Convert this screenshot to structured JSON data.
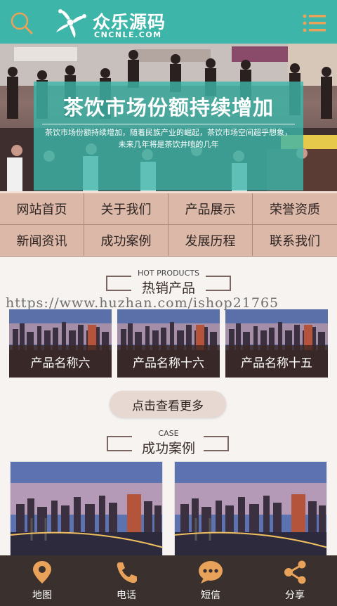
{
  "header": {
    "logo_title": "众乐源码",
    "logo_sub": "CNCNLE.COM",
    "search_icon": "search-icon",
    "menu_icon": "list-menu-icon",
    "accent": "#3db5a8"
  },
  "banner": {
    "title": "茶饮市场份额持续增加",
    "text": "茶饮市场份额持续增加，随着民族产业的崛起，茶饮市场空间超乎想象，未来几年将是茶饮井喷的几年"
  },
  "nav": {
    "items": [
      {
        "label": "网站首页"
      },
      {
        "label": "关于我们"
      },
      {
        "label": "产品展示"
      },
      {
        "label": "荣誉资质"
      },
      {
        "label": "新闻资讯"
      },
      {
        "label": "成功案例"
      },
      {
        "label": "发展历程"
      },
      {
        "label": "联系我们"
      }
    ]
  },
  "hot": {
    "en": "HOT PRODUCTS",
    "cn": "热销产品"
  },
  "watermark": "https://www.huzhan.com/ishop21765",
  "products": [
    {
      "label": "产品名称六"
    },
    {
      "label": "产品名称十六"
    },
    {
      "label": "产品名称十五"
    }
  ],
  "more_label": "点击查看更多",
  "case_section": {
    "en": "CASE",
    "cn": "成功案例"
  },
  "footer": [
    {
      "label": "地图",
      "icon": "map-pin-icon"
    },
    {
      "label": "电话",
      "icon": "phone-icon"
    },
    {
      "label": "短信",
      "icon": "chat-bubble-icon"
    },
    {
      "label": "分享",
      "icon": "share-icon"
    }
  ]
}
